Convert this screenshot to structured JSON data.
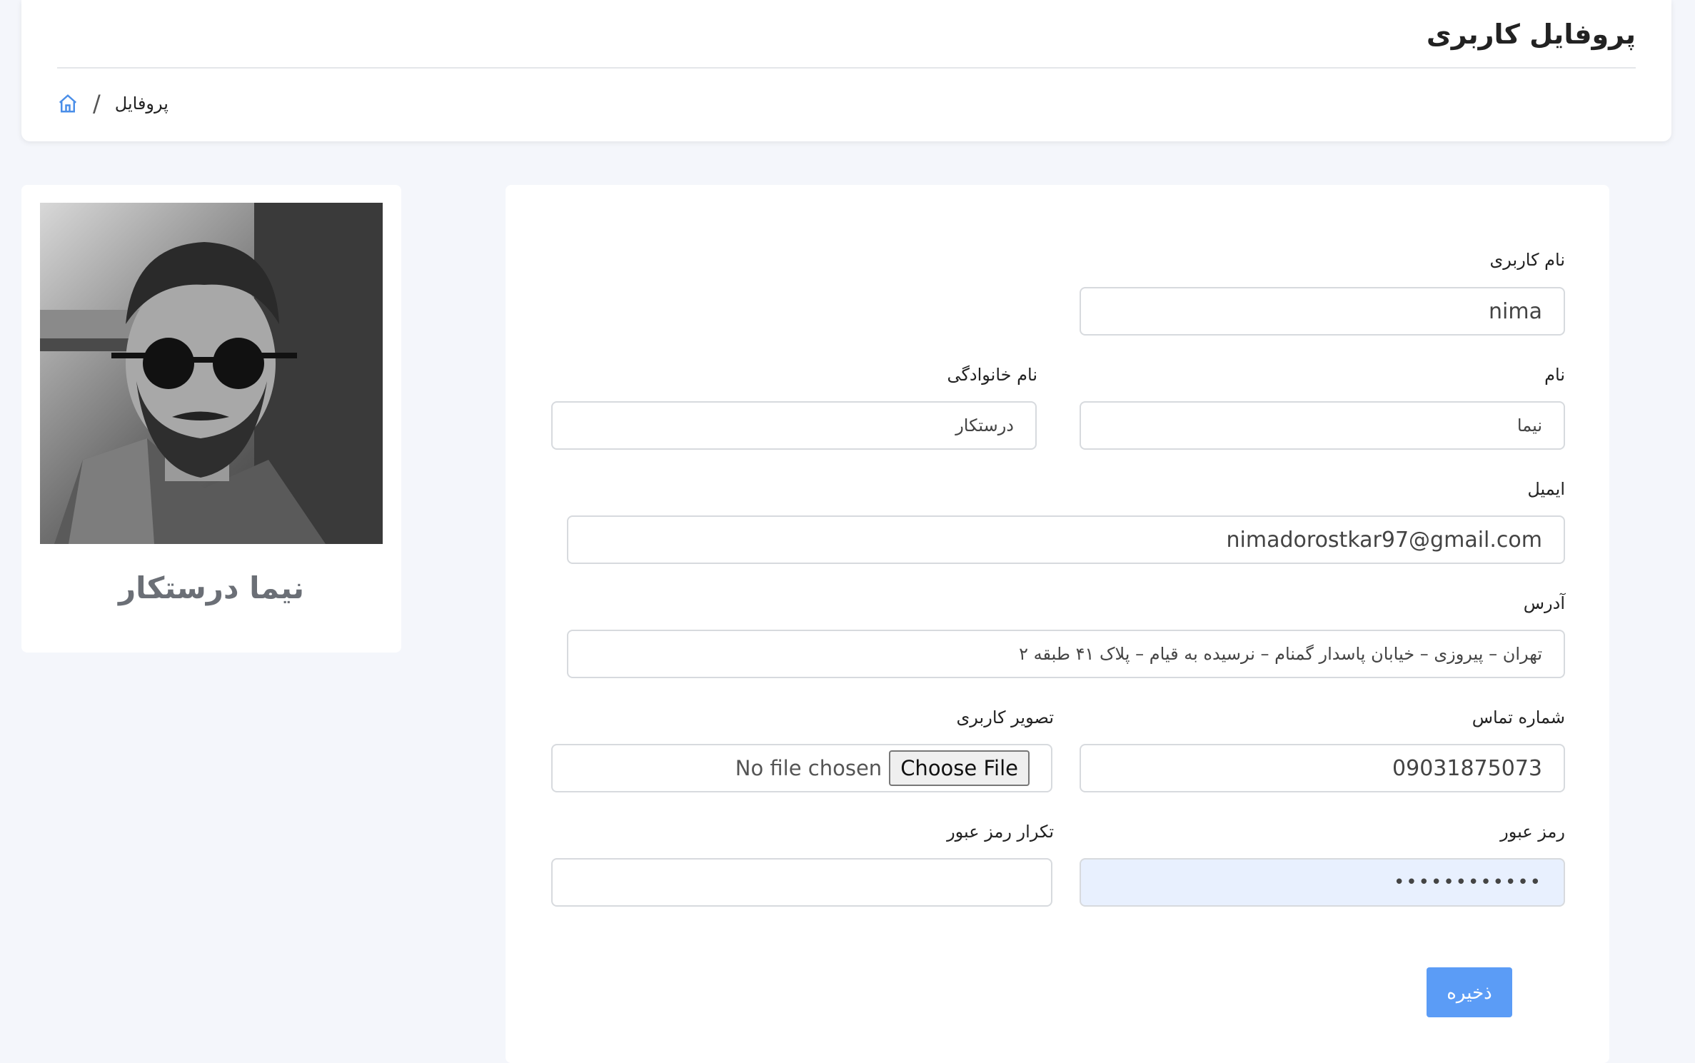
{
  "header": {
    "title": "پروفایل کاربری",
    "breadcrumb": {
      "home_icon": "home-icon",
      "separator": "/",
      "current": "پروفایل"
    }
  },
  "profile": {
    "name": "نیما درستکار",
    "avatar": "profile photo"
  },
  "form": {
    "username": {
      "label": "نام کاربری",
      "value": "nima"
    },
    "first_name": {
      "label": "نام",
      "value": "نیما"
    },
    "last_name": {
      "label": "نام خانوادگی",
      "value": "درستکار"
    },
    "email": {
      "label": "ایمیل",
      "value": "nimadorostkar97@gmail.com"
    },
    "address": {
      "label": "آدرس",
      "value": "تهران – پیروزی – خیابان پاسدار گمنام – نرسیده به قیام – پلاک ۴۱ طبقه ۲"
    },
    "phone": {
      "label": "شماره تماس",
      "value": "09031875073"
    },
    "avatar_upload": {
      "label": "تصویر کاربری",
      "button": "Choose File",
      "status": "No file chosen"
    },
    "password": {
      "label": "رمز عبور",
      "value": "••••••••••••"
    },
    "password_confirm": {
      "label": "تکرار رمز عبور",
      "value": ""
    },
    "save_label": "ذخیره"
  },
  "colors": {
    "accent": "#5b9cf6",
    "autofill": "#e8f0fe",
    "background": "#f4f6fb"
  }
}
